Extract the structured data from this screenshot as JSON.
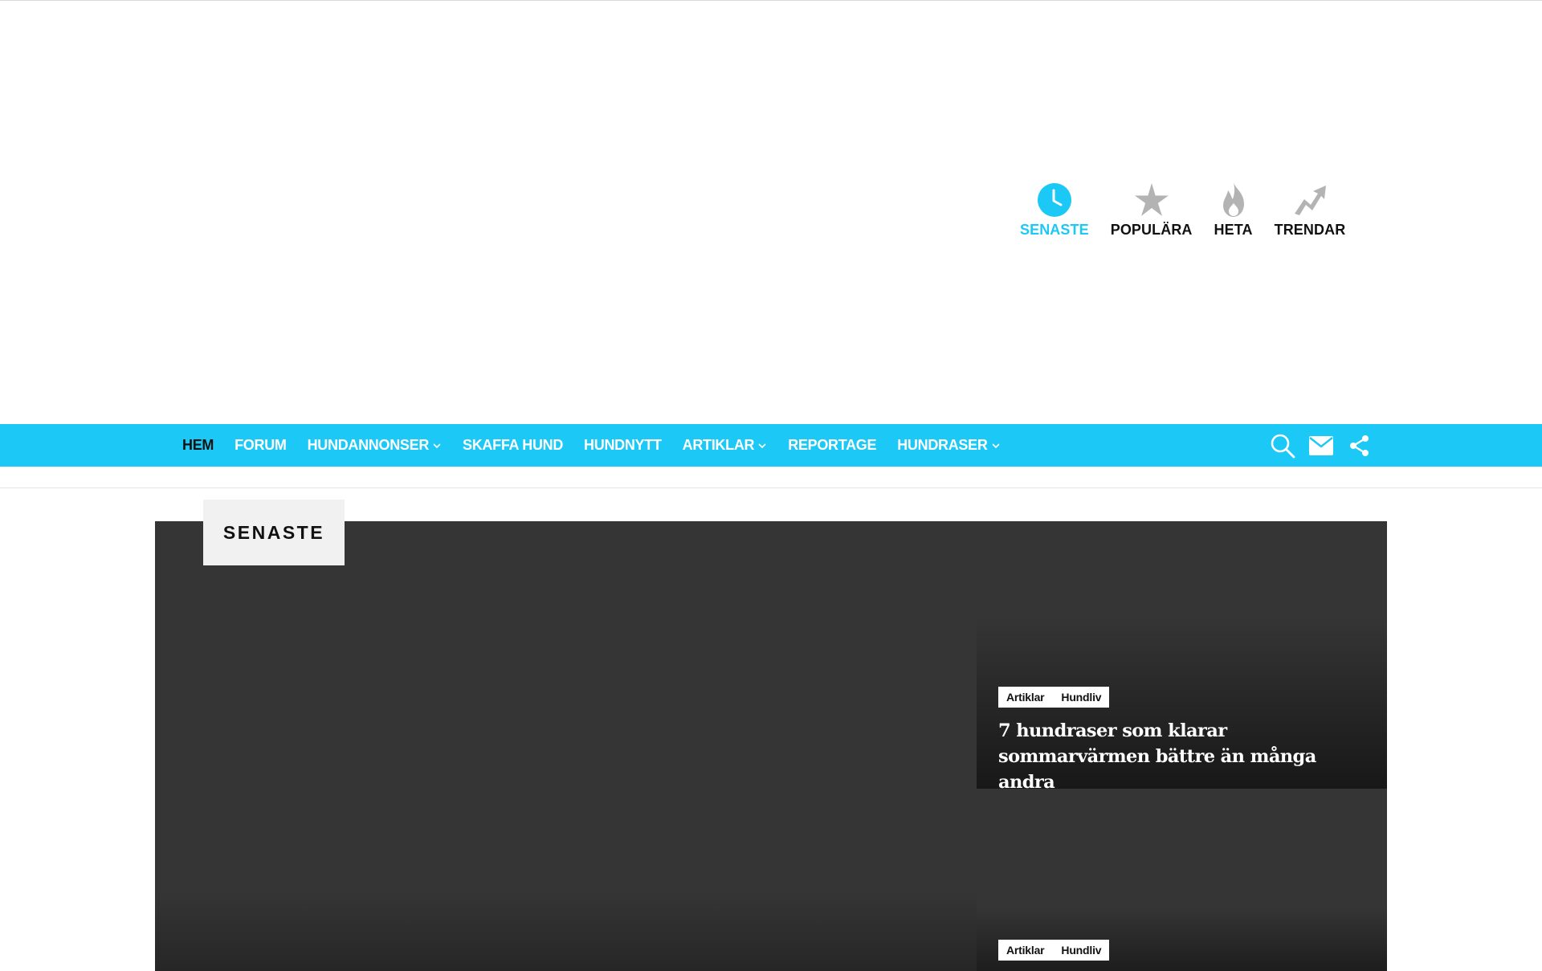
{
  "categories": [
    {
      "label": "SENASTE",
      "icon": "clock-icon",
      "active": true
    },
    {
      "label": "POPULÄRA",
      "icon": "star-icon",
      "active": false
    },
    {
      "label": "HETA",
      "icon": "flame-icon",
      "active": false
    },
    {
      "label": "TRENDAR",
      "icon": "trending-arrow-icon",
      "active": false
    }
  ],
  "nav": {
    "items": [
      {
        "label": "HEM",
        "active": true,
        "dropdown": false
      },
      {
        "label": "FORUM",
        "active": false,
        "dropdown": false
      },
      {
        "label": "HUNDANNONSER",
        "active": false,
        "dropdown": true
      },
      {
        "label": "SKAFFA HUND",
        "active": false,
        "dropdown": false
      },
      {
        "label": "HUNDNYTT",
        "active": false,
        "dropdown": false
      },
      {
        "label": "ARTIKLAR",
        "active": false,
        "dropdown": true
      },
      {
        "label": "REPORTAGE",
        "active": false,
        "dropdown": false
      },
      {
        "label": "HUNDRASER",
        "active": false,
        "dropdown": true
      }
    ],
    "icons": [
      "search-icon",
      "mail-icon",
      "share-icon"
    ]
  },
  "hero": {
    "section_label": "SENASTE",
    "cards": [
      {
        "tags": [
          "Artiklar",
          "Hundliv"
        ],
        "title": "7 hundraser som klarar sommarvärmen bättre än många andra"
      },
      {
        "tags": [
          "Artiklar",
          "Hundliv"
        ],
        "title": ""
      }
    ]
  },
  "colors": {
    "accent": "#1cc8f5",
    "hero_bg": "#353535",
    "tab_bg": "#f1f1f1"
  }
}
